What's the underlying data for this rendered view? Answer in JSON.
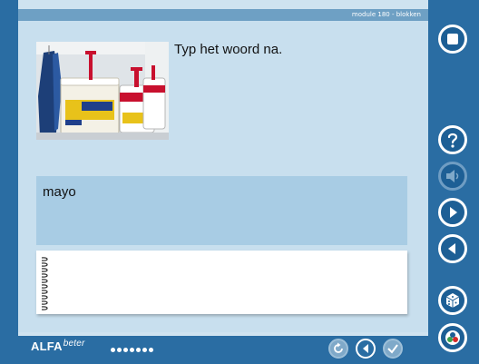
{
  "module": {
    "label": "module 180 - blokken"
  },
  "exercise": {
    "instruction": "Typ het woord na.",
    "word": "mayo",
    "answer": {
      "value": "",
      "placeholder": ""
    }
  },
  "photo": {
    "icon": "paint-buckets-photo"
  },
  "footer": {
    "brand_main": "ALFA",
    "brand_sup": "beter",
    "progress_dots": 7
  },
  "sidebar": {
    "buttons": [
      "stop-icon",
      "help-icon",
      "speaker-icon",
      "next-icon",
      "previous-icon",
      "dice-icon",
      "palette-icon"
    ]
  },
  "footer_buttons": [
    "replay-icon",
    "play-icon",
    "check-icon"
  ],
  "colors": {
    "panel": "#2a6da3",
    "content": "#c8dfee",
    "word_box": "#a8cce4",
    "module_bar": "#6ea0c4"
  }
}
